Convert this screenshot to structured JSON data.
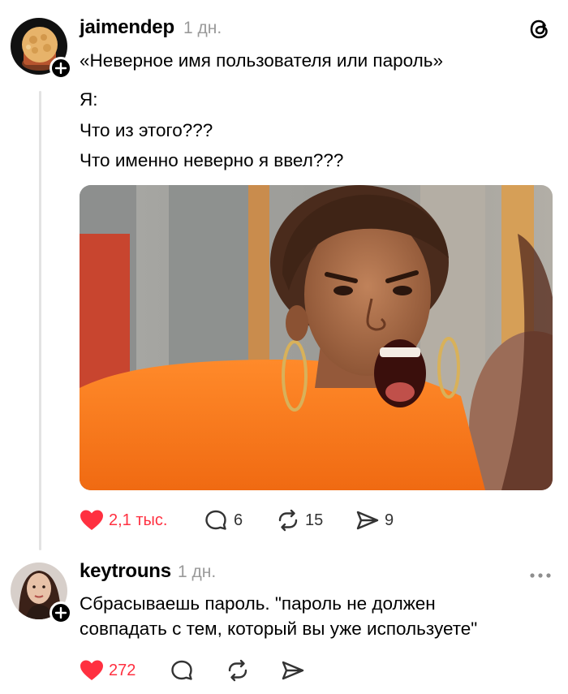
{
  "post": {
    "username": "jaimendep",
    "time": "1 дн.",
    "title": "«Неверное имя пользователя или пароль»",
    "lines": [
      "Я:",
      "Что из этого???",
      "Что именно неверно я ввел???"
    ],
    "image": {
      "alt": "Кричащая женщина в оранжевой футболке"
    },
    "likes": "2,1 тыс.",
    "comments": "6",
    "reposts": "15",
    "shares": "9"
  },
  "reply": {
    "username": "keytrouns",
    "time": "1 дн.",
    "line1": "Сбрасываешь пароль. \"пароль не должен",
    "line2": "совпадать с тем, который вы уже используете\"",
    "likes": "272"
  },
  "icons": {
    "brand": "threads-logo-icon",
    "like": "heart-icon",
    "comment": "comment-bubble-icon",
    "repost": "repost-icon",
    "share": "send-icon",
    "more": "more-dots-icon",
    "follow": "plus-icon"
  },
  "colors": {
    "like_active": "#ff3040",
    "muted_text": "#9a9a9a",
    "thread_line": "#e3e3e3"
  }
}
